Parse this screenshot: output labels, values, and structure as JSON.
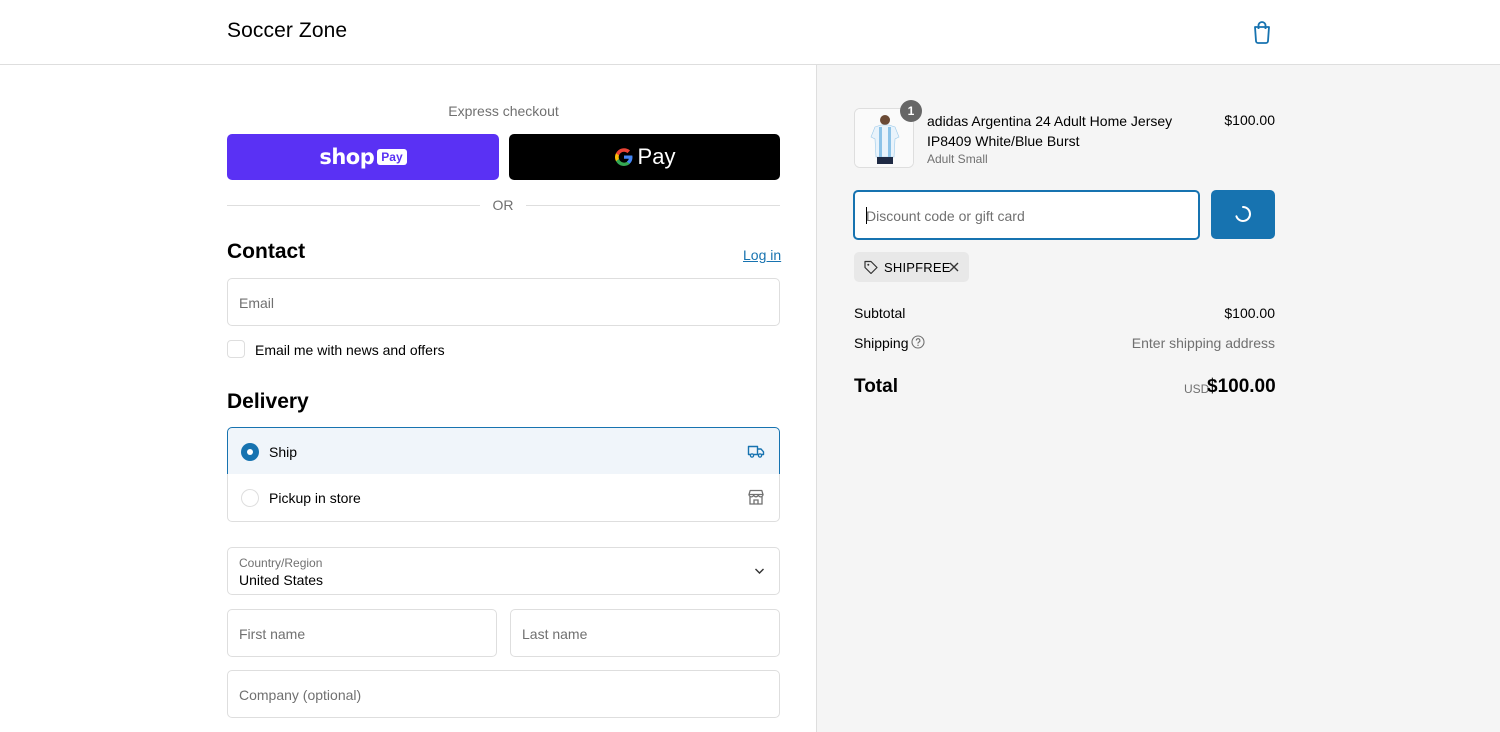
{
  "header": {
    "store_name": "Soccer Zone",
    "cart_icon": "shopping-bag-icon"
  },
  "express": {
    "title": "Express checkout",
    "shop_pay_word": "shop",
    "shop_pay_badge": "Pay",
    "gpay_label": "Pay",
    "or_text": "OR"
  },
  "contact": {
    "title": "Contact",
    "login_link": "Log in",
    "email_placeholder": "Email",
    "newsletter_label": "Email me with news and offers"
  },
  "delivery": {
    "title": "Delivery",
    "options": [
      {
        "label": "Ship",
        "selected": true,
        "icon": "truck-icon"
      },
      {
        "label": "Pickup in store",
        "selected": false,
        "icon": "store-icon"
      }
    ],
    "country_label": "Country/Region",
    "country_value": "United States",
    "first_name_placeholder": "First name",
    "last_name_placeholder": "Last name",
    "company_placeholder": "Company (optional)"
  },
  "summary": {
    "item": {
      "quantity": "1",
      "title": "adidas Argentina 24 Adult Home Jersey IP8409 White/Blue Burst",
      "variant": "Adult Small",
      "price": "$100.00"
    },
    "discount_placeholder": "Discount code or gift card",
    "applied_code": "SHIPFREE",
    "subtotal_label": "Subtotal",
    "subtotal_value": "$100.00",
    "shipping_label": "Shipping",
    "shipping_value": "Enter shipping address",
    "total_label": "Total",
    "total_currency": "USD",
    "total_value": "$100.00"
  },
  "colors": {
    "accent": "#1773b0",
    "shop_pay": "#5a31f4",
    "muted_text": "#707070",
    "summary_bg": "#f5f5f5"
  }
}
